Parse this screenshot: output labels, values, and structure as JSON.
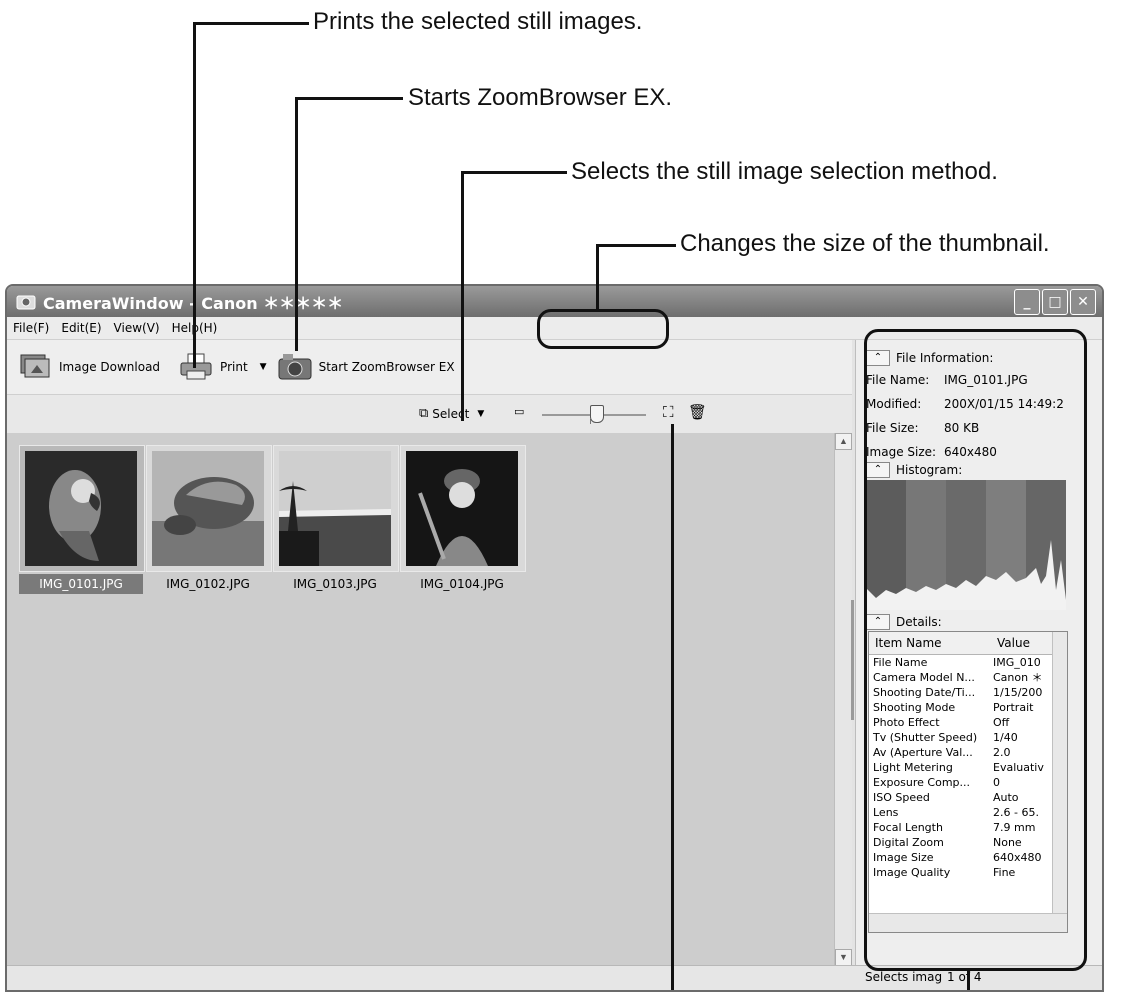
{
  "callouts": {
    "print": "Prints the selected still images.",
    "zoombrowser": "Starts ZoomBrowser EX.",
    "select": "Selects the still image selection method.",
    "thumb_size": "Changes the size of the thumbnail."
  },
  "window": {
    "title": "CameraWindow - Canon ＊＊＊＊＊",
    "menu": [
      "File(F)",
      "Edit(E)",
      "View(V)",
      "Help(H)"
    ]
  },
  "toolbar": {
    "download_label": "Image Download",
    "print_label": "Print",
    "zoombrowser_label": "Start ZoomBrowser EX",
    "select_label": "Select"
  },
  "thumbnails": [
    {
      "label": "IMG_0101.JPG",
      "selected": true
    },
    {
      "label": "IMG_0102.JPG",
      "selected": false
    },
    {
      "label": "IMG_0103.JPG",
      "selected": false
    },
    {
      "label": "IMG_0104.JPG",
      "selected": false
    }
  ],
  "file_info": {
    "header": "File Information:",
    "rows": [
      {
        "key": "File Name:",
        "value": "IMG_0101.JPG"
      },
      {
        "key": "Modified:",
        "value": "200X/01/15 14:49:2"
      },
      {
        "key": "File Size:",
        "value": "80 KB"
      },
      {
        "key": "Image Size:",
        "value": "640x480"
      }
    ]
  },
  "histogram": {
    "header": "Histogram:"
  },
  "details": {
    "header": "Details:",
    "col_item": "Item Name",
    "col_value": "Value",
    "rows": [
      [
        "File Name",
        "IMG_010"
      ],
      [
        "Camera Model N...",
        "Canon ＊"
      ],
      [
        "Shooting Date/Ti...",
        "1/15/200"
      ],
      [
        "Shooting Mode",
        "Portrait"
      ],
      [
        "Photo Effect",
        "Off"
      ],
      [
        "Tv (Shutter Speed)",
        "1/40"
      ],
      [
        "Av (Aperture Val...",
        "2.0"
      ],
      [
        "Light Metering",
        "Evaluativ"
      ],
      [
        "Exposure Comp...",
        "0"
      ],
      [
        "ISO Speed",
        "Auto"
      ],
      [
        "Lens",
        "2.6 - 65."
      ],
      [
        "Focal Length",
        "7.9 mm"
      ],
      [
        "Digital Zoom",
        "None"
      ],
      [
        "Image Size",
        "640x480"
      ],
      [
        "Image Quality",
        "Fine"
      ]
    ]
  },
  "status": {
    "text": "Selects imag",
    "count": "1 of 4"
  }
}
